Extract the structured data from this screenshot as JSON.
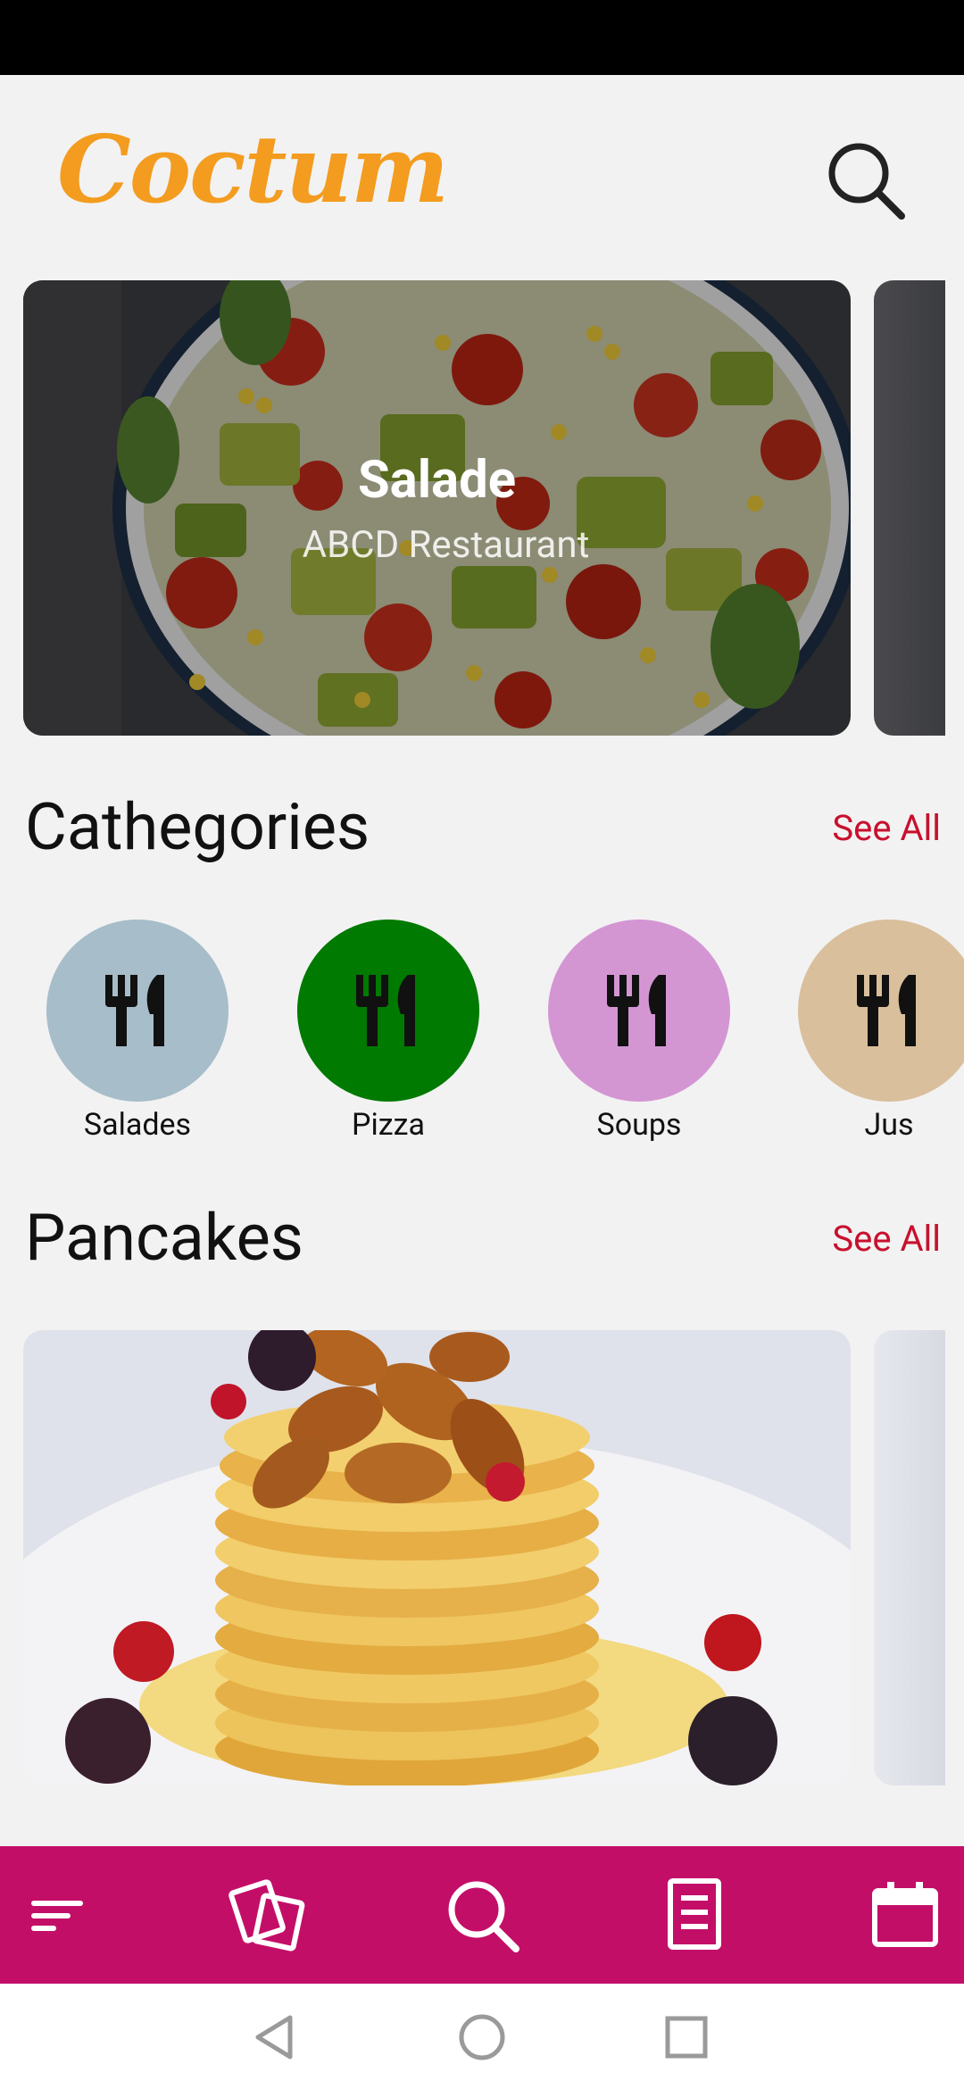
{
  "app": {
    "name": "Coctum"
  },
  "header": {
    "search_icon": "search-icon"
  },
  "featured": [
    {
      "title": "Salade",
      "subtitle": "ABCD Restaurant"
    }
  ],
  "categories_section": {
    "title": "Cathegories",
    "see_all": "See All",
    "items": [
      {
        "label": "Salades",
        "color": "#a7bdc9",
        "icon": "fork-knife-icon"
      },
      {
        "label": "Pizza",
        "color": "#007a00",
        "icon": "fork-knife-icon"
      },
      {
        "label": "Soups",
        "color": "#d396d3",
        "icon": "fork-knife-icon"
      },
      {
        "label": "Jus",
        "color": "#d9bf9c",
        "icon": "fork-knife-icon"
      }
    ]
  },
  "pancakes_section": {
    "title": "Pancakes",
    "see_all": "See All"
  },
  "bottom_nav": {
    "background": "#c30e68",
    "items": [
      "menu-icon",
      "cards-icon",
      "search-icon",
      "document-icon",
      "calendar-icon"
    ]
  },
  "colors": {
    "accent": "#c8102e",
    "logo": "#f39c1f"
  }
}
